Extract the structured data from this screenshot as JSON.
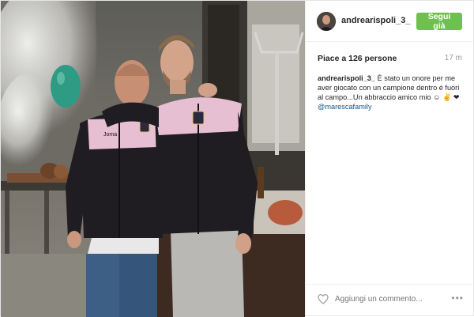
{
  "post": {
    "username": "andrearispoli_3_",
    "follow_label": "Segui già",
    "likes": "Piace a 126 persone",
    "time": "17 m",
    "caption": {
      "user": "andrearispoli_3_",
      "text": " È stato un onore per me aver giocato con un campione dentro é fuori al campo...Un abbraccio amico mio ☺ ✌ ❤ ",
      "mention": "@marescafamily"
    },
    "comment_placeholder": "Aggiungi un commento...",
    "more_label": "•••"
  },
  "photo": {
    "jersey_brand": "Joma"
  },
  "icons": {
    "avatar": "avatar-icon",
    "like": "heart-icon",
    "more": "more-options-icon"
  },
  "colors": {
    "follow_button": "#70c050",
    "mention": "#125688",
    "jacket": "#1f1d22",
    "jacket_panel": "#e7bfd3"
  }
}
